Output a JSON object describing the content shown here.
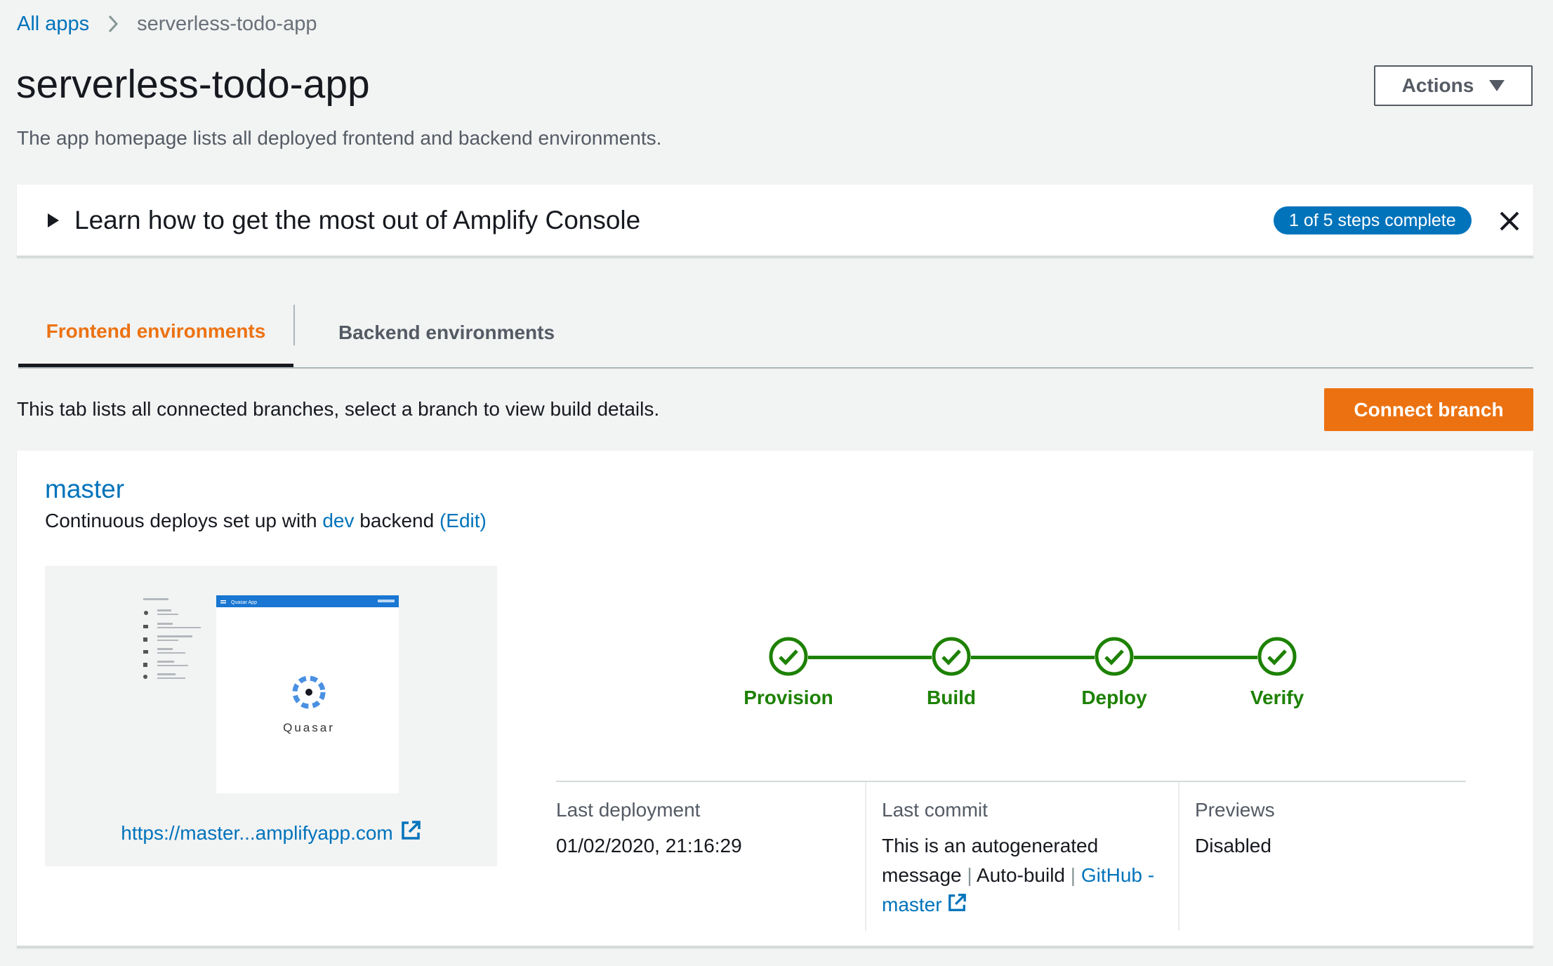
{
  "breadcrumb": {
    "root": "All apps",
    "current": "serverless-todo-app"
  },
  "page": {
    "title": "serverless-todo-app",
    "subtitle": "The app homepage lists all deployed frontend and backend environments.",
    "actions_label": "Actions"
  },
  "learn": {
    "title": "Learn how to get the most out of Amplify Console",
    "badge": "1 of 5 steps complete"
  },
  "tabs": [
    {
      "label": "Frontend environments",
      "active": true
    },
    {
      "label": "Backend environments",
      "active": false
    }
  ],
  "tab_description": "This tab lists all connected branches, select a branch to view build details.",
  "connect_branch_label": "Connect branch",
  "branch": {
    "name": "master",
    "desc_prefix": "Continuous deploys set up with",
    "backend_link": "dev",
    "desc_suffix": "backend",
    "edit_link": "(Edit)",
    "preview_url": "https://master...amplifyapp.com",
    "preview_app_title": "Quasar App",
    "preview_logo_text": "Quasar",
    "stages": [
      "Provision",
      "Build",
      "Deploy",
      "Verify"
    ],
    "details": {
      "last_deployment_label": "Last deployment",
      "last_deployment_value": "01/02/2020, 21:16:29",
      "last_commit_label": "Last commit",
      "commit_message": "This is an autogenerated message",
      "commit_type": "Auto-build",
      "commit_link": "GitHub - master",
      "previews_label": "Previews",
      "previews_value": "Disabled"
    }
  },
  "colors": {
    "accent_orange": "#ec7211",
    "link_blue": "#0073bb",
    "success_green": "#1d8102"
  }
}
